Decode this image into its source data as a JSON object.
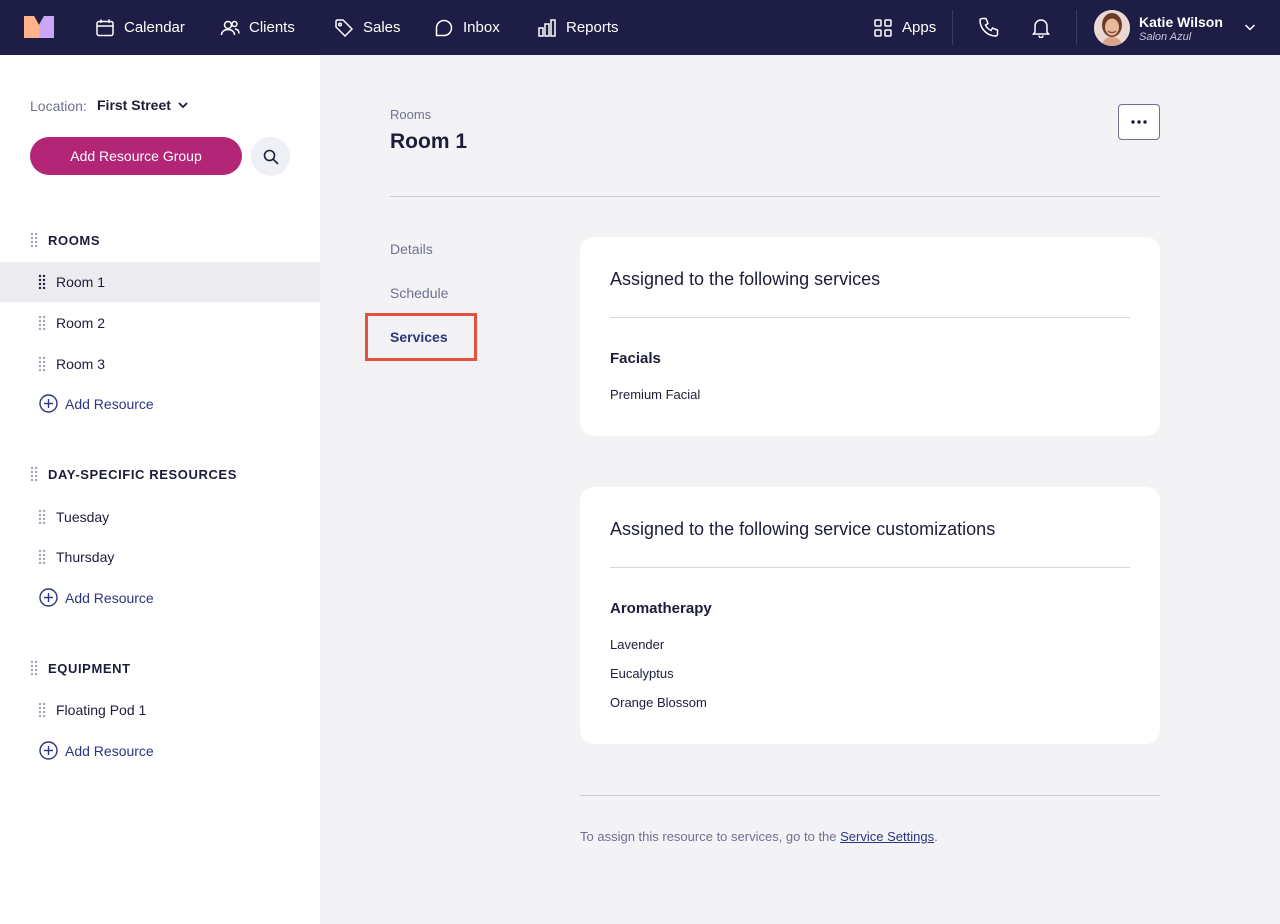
{
  "nav": {
    "items": [
      {
        "label": "Calendar",
        "icon": "calendar-icon"
      },
      {
        "label": "Clients",
        "icon": "users-icon"
      },
      {
        "label": "Sales",
        "icon": "tag-icon"
      },
      {
        "label": "Inbox",
        "icon": "chat-icon"
      },
      {
        "label": "Reports",
        "icon": "bar-chart-icon"
      }
    ],
    "apps_label": "Apps",
    "user": {
      "name": "Katie Wilson",
      "salon": "Salon Azul"
    }
  },
  "sidebar": {
    "location_label": "Location:",
    "location_value": "First Street",
    "add_group_label": "Add Resource Group",
    "groups": [
      {
        "title": "ROOMS",
        "items": [
          "Room 1",
          "Room 2",
          "Room 3"
        ],
        "add_label": "Add Resource"
      },
      {
        "title": "DAY-SPECIFIC RESOURCES",
        "items": [
          "Tuesday",
          "Thursday"
        ],
        "add_label": "Add Resource"
      },
      {
        "title": "EQUIPMENT",
        "items": [
          "Floating Pod 1"
        ],
        "add_label": "Add Resource"
      }
    ],
    "active_item": "Room 1"
  },
  "main": {
    "breadcrumb": "Rooms",
    "title": "Room 1",
    "tabs": [
      "Details",
      "Schedule",
      "Services"
    ],
    "active_tab": "Services",
    "services_card": {
      "title": "Assigned to the following services",
      "group": "Facials",
      "items": [
        "Premium Facial"
      ]
    },
    "customizations_card": {
      "title": "Assigned to the following service customizations",
      "group": "Aromatherapy",
      "items": [
        "Lavender",
        "Eucalyptus",
        "Orange Blossom"
      ]
    },
    "footer_text": "To assign this resource to services, go to the",
    "footer_link": "Service Settings",
    "footer_end": "."
  },
  "colors": {
    "topbar": "#1e1d45",
    "primary_button": "#b32577",
    "link": "#2d3580",
    "highlight": "#e0533e"
  }
}
